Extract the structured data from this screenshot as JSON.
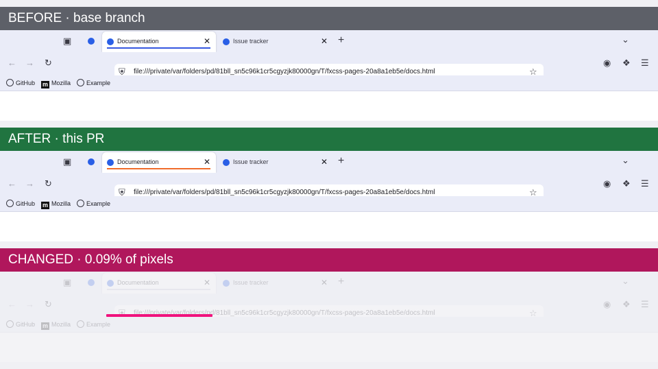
{
  "panels": [
    {
      "banner": "BEFORE · base branch",
      "banner_color": "#5d6068",
      "underline_color": "#3557e0",
      "faded": false
    },
    {
      "banner": "AFTER · this PR",
      "banner_color": "#207440",
      "underline_color": "#f06b2a",
      "faded": false
    },
    {
      "banner": "CHANGED · 0.09% of pixels",
      "banner_color": "#b0175c",
      "underline_color": "#c9c9d6",
      "faded": true,
      "highlight_color": "#f0127d"
    }
  ],
  "browser": {
    "active_tab": "Documentation",
    "inactive_tab": "Issue tracker",
    "url": "file:///private/var/folders/pd/81bll_sn5c96k1cr5cgyzjk80000gn/T/fxcss-pages-20a8a1eb5e/docs.html",
    "bookmarks": [
      "GitHub",
      "Mozilla",
      "Example"
    ]
  },
  "icons": [
    "tab-overview-icon",
    "close-icon",
    "plus-icon",
    "chevron-down-icon",
    "back-icon",
    "forward-icon",
    "reload-icon",
    "shield-icon",
    "star-icon",
    "account-icon",
    "extensions-icon",
    "menu-icon",
    "globe-icon",
    "mozilla-icon"
  ]
}
